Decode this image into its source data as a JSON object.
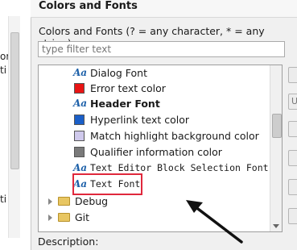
{
  "left_pane": {
    "fragments": [
      "or",
      "ti",
      "ti"
    ]
  },
  "page": {
    "title": "Colors and Fonts",
    "description": "Colors and Fonts (? = any character, * = any string):",
    "filter_placeholder": "type filter text",
    "bottom_label": "Description:"
  },
  "tree": {
    "items": [
      {
        "label": "Dialog Font",
        "icon": "font-icon"
      },
      {
        "label": "Error text color",
        "icon": "color-swatch-icon",
        "color": "#e81414"
      },
      {
        "label": "Header Font",
        "icon": "font-icon"
      },
      {
        "label": "Hyperlink text color",
        "icon": "color-swatch-icon",
        "color": "#1a5fc8"
      },
      {
        "label": "Match highlight background color",
        "icon": "color-swatch-icon",
        "color": "#cfc9ec"
      },
      {
        "label": "Qualifier information color",
        "icon": "color-swatch-icon",
        "color": "#7a7a7a"
      },
      {
        "label": "Text Editor Block Selection Font",
        "icon": "font-icon"
      },
      {
        "label": "Text Font",
        "icon": "font-icon"
      }
    ],
    "groups": [
      {
        "label": "Debug",
        "icon": "folder-icon"
      },
      {
        "label": "Git",
        "icon": "folder-icon"
      }
    ],
    "font_glyph": "Aa"
  },
  "side_buttons": [
    "",
    "U",
    "",
    "",
    "",
    "",
    "",
    ""
  ],
  "colors": {
    "highlight": "#e0283c",
    "annotation_arrow": "#111111"
  }
}
